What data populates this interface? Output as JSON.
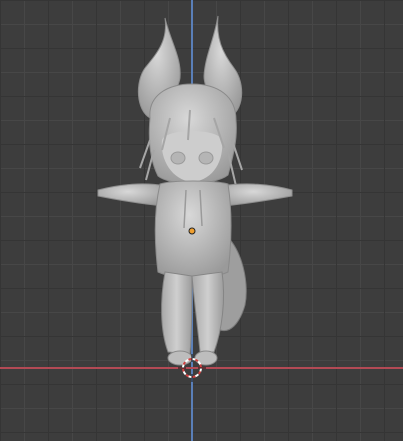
{
  "viewport": {
    "background": "#3d3d3d",
    "grid_minor": "#353535",
    "grid_major": "#474747",
    "axis_x_color": "#b34a55",
    "axis_y_color": "#5a7fb8"
  },
  "scene": {
    "model": "chibi-fox-ear-character-tpose",
    "shading": "solid",
    "model_color": "#c9c9c9",
    "origin_color": "#f0a030",
    "cursor_icon": "3d-cursor-icon"
  }
}
